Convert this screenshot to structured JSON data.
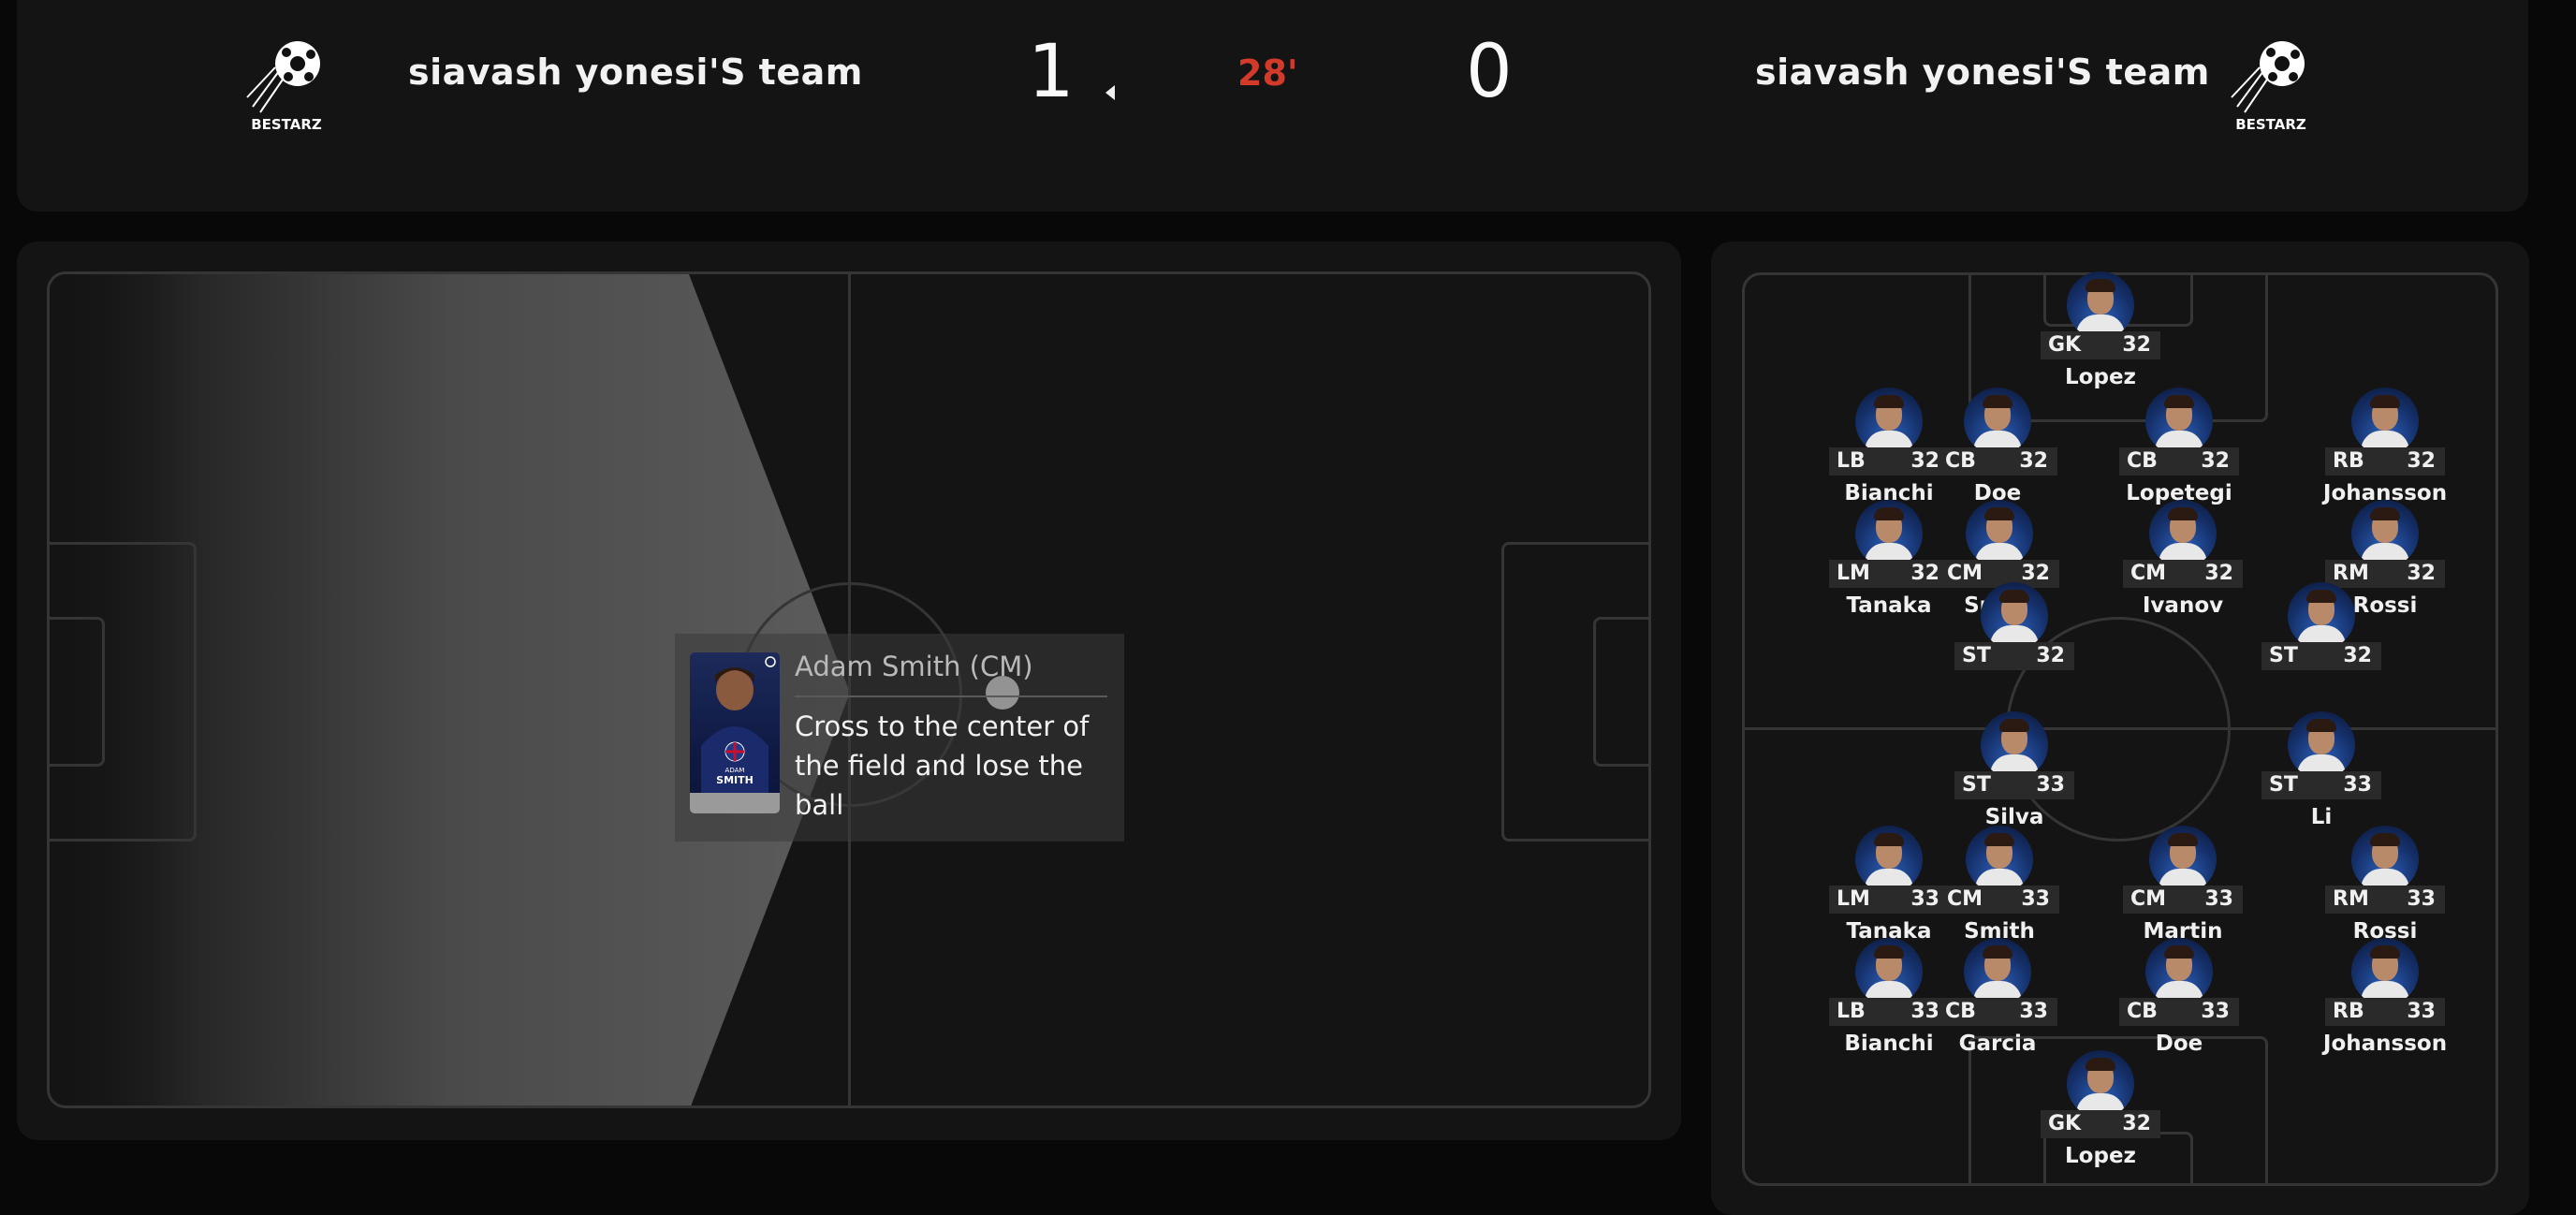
{
  "header": {
    "home_team": "siavash yonesi'S team",
    "away_team": "siavash yonesi'S team",
    "home_score": "1",
    "away_score": "0",
    "clock": "28'",
    "home_logo_text": "BESTARZ",
    "away_logo_text": "BESTARZ"
  },
  "event": {
    "player": "Adam Smith (CM)",
    "description": "Cross to the center of the field and lose the ball",
    "card_first_name": "ADAM",
    "card_last_name": "SMITH"
  },
  "colors": {
    "clock": "#d23a2a",
    "background": "#080808",
    "card": "#141414",
    "field_lines": "#353535"
  },
  "lineup": {
    "away": [
      {
        "pos": "GK",
        "rating": "32",
        "name": "Lopez"
      },
      {
        "pos": "LB",
        "rating": "32",
        "name": "Bianchi"
      },
      {
        "pos": "CB",
        "rating": "32",
        "name": "Doe"
      },
      {
        "pos": "CB",
        "rating": "32",
        "name": "Lopetegi"
      },
      {
        "pos": "RB",
        "rating": "32",
        "name": "Johansson"
      },
      {
        "pos": "LM",
        "rating": "32",
        "name": "Tanaka"
      },
      {
        "pos": "CM",
        "rating": "32",
        "name": "Smith"
      },
      {
        "pos": "CM",
        "rating": "32",
        "name": "Ivanov"
      },
      {
        "pos": "RM",
        "rating": "32",
        "name": "Rossi"
      },
      {
        "pos": "ST",
        "rating": "32",
        "name": ""
      },
      {
        "pos": "ST",
        "rating": "32",
        "name": ""
      }
    ],
    "home": [
      {
        "pos": "ST",
        "rating": "33",
        "name": "Silva"
      },
      {
        "pos": "ST",
        "rating": "33",
        "name": "Li"
      },
      {
        "pos": "LM",
        "rating": "33",
        "name": "Tanaka"
      },
      {
        "pos": "CM",
        "rating": "33",
        "name": "Smith"
      },
      {
        "pos": "CM",
        "rating": "33",
        "name": "Martin"
      },
      {
        "pos": "RM",
        "rating": "33",
        "name": "Rossi"
      },
      {
        "pos": "LB",
        "rating": "33",
        "name": "Bianchi"
      },
      {
        "pos": "CB",
        "rating": "33",
        "name": "Garcia"
      },
      {
        "pos": "CB",
        "rating": "33",
        "name": "Doe"
      },
      {
        "pos": "RB",
        "rating": "33",
        "name": "Johansson"
      },
      {
        "pos": "GK",
        "rating": "32",
        "name": "Lopez"
      }
    ]
  }
}
